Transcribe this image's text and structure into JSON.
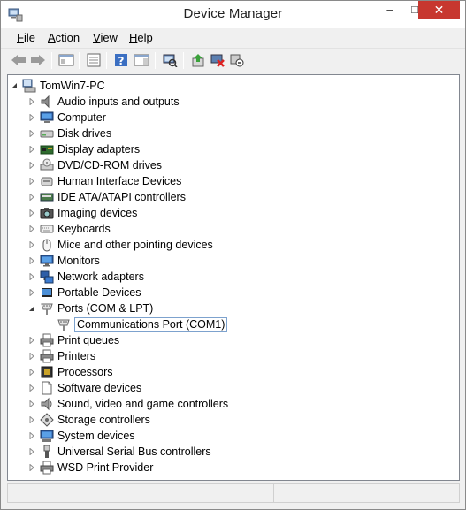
{
  "window": {
    "title": "Device Manager"
  },
  "titlebar": {
    "minimize": "–",
    "maximize": "□",
    "close": "✕"
  },
  "menu": [
    {
      "label": "File",
      "key": "F",
      "rest": "ile"
    },
    {
      "label": "Action",
      "key": "A",
      "rest": "ction"
    },
    {
      "label": "View",
      "key": "V",
      "rest": "iew"
    },
    {
      "label": "Help",
      "key": "H",
      "rest": "elp"
    }
  ],
  "toolbar": {
    "buttons": [
      "back-icon",
      "forward-icon",
      "show-hide-console-tree-icon",
      "properties-icon",
      "help-icon",
      "action-pane-icon",
      "scan-hardware-icon",
      "update-driver-icon",
      "uninstall-icon",
      "disable-device-icon"
    ]
  },
  "tree": {
    "root": "TomWin7-PC",
    "categories": [
      {
        "label": "Audio inputs and outputs",
        "icon": "speaker-icon"
      },
      {
        "label": "Computer",
        "icon": "computer-icon"
      },
      {
        "label": "Disk drives",
        "icon": "disk-drive-icon"
      },
      {
        "label": "Display adapters",
        "icon": "display-adapter-icon"
      },
      {
        "label": "DVD/CD-ROM drives",
        "icon": "dvd-drive-icon"
      },
      {
        "label": "Human Interface Devices",
        "icon": "hid-icon"
      },
      {
        "label": "IDE ATA/ATAPI controllers",
        "icon": "ide-controller-icon"
      },
      {
        "label": "Imaging devices",
        "icon": "camera-icon"
      },
      {
        "label": "Keyboards",
        "icon": "keyboard-icon"
      },
      {
        "label": "Mice and other pointing devices",
        "icon": "mouse-icon"
      },
      {
        "label": "Monitors",
        "icon": "monitor-icon"
      },
      {
        "label": "Network adapters",
        "icon": "network-adapter-icon"
      },
      {
        "label": "Portable Devices",
        "icon": "portable-device-icon"
      },
      {
        "label": "Ports (COM & LPT)",
        "icon": "port-icon",
        "expanded": true,
        "children": [
          {
            "label": "Communications Port (COM1)",
            "icon": "port-icon",
            "selected": true
          }
        ]
      },
      {
        "label": "Print queues",
        "icon": "printer-icon"
      },
      {
        "label": "Printers",
        "icon": "printer-icon"
      },
      {
        "label": "Processors",
        "icon": "processor-icon"
      },
      {
        "label": "Software devices",
        "icon": "software-device-icon"
      },
      {
        "label": "Sound, video and game controllers",
        "icon": "sound-icon"
      },
      {
        "label": "Storage controllers",
        "icon": "storage-controller-icon"
      },
      {
        "label": "System devices",
        "icon": "system-device-icon"
      },
      {
        "label": "Universal Serial Bus controllers",
        "icon": "usb-icon"
      },
      {
        "label": "WSD Print Provider",
        "icon": "printer-icon"
      }
    ]
  },
  "colors": {
    "selection_border": "#7da2ce",
    "close_button": "#c7372f"
  }
}
